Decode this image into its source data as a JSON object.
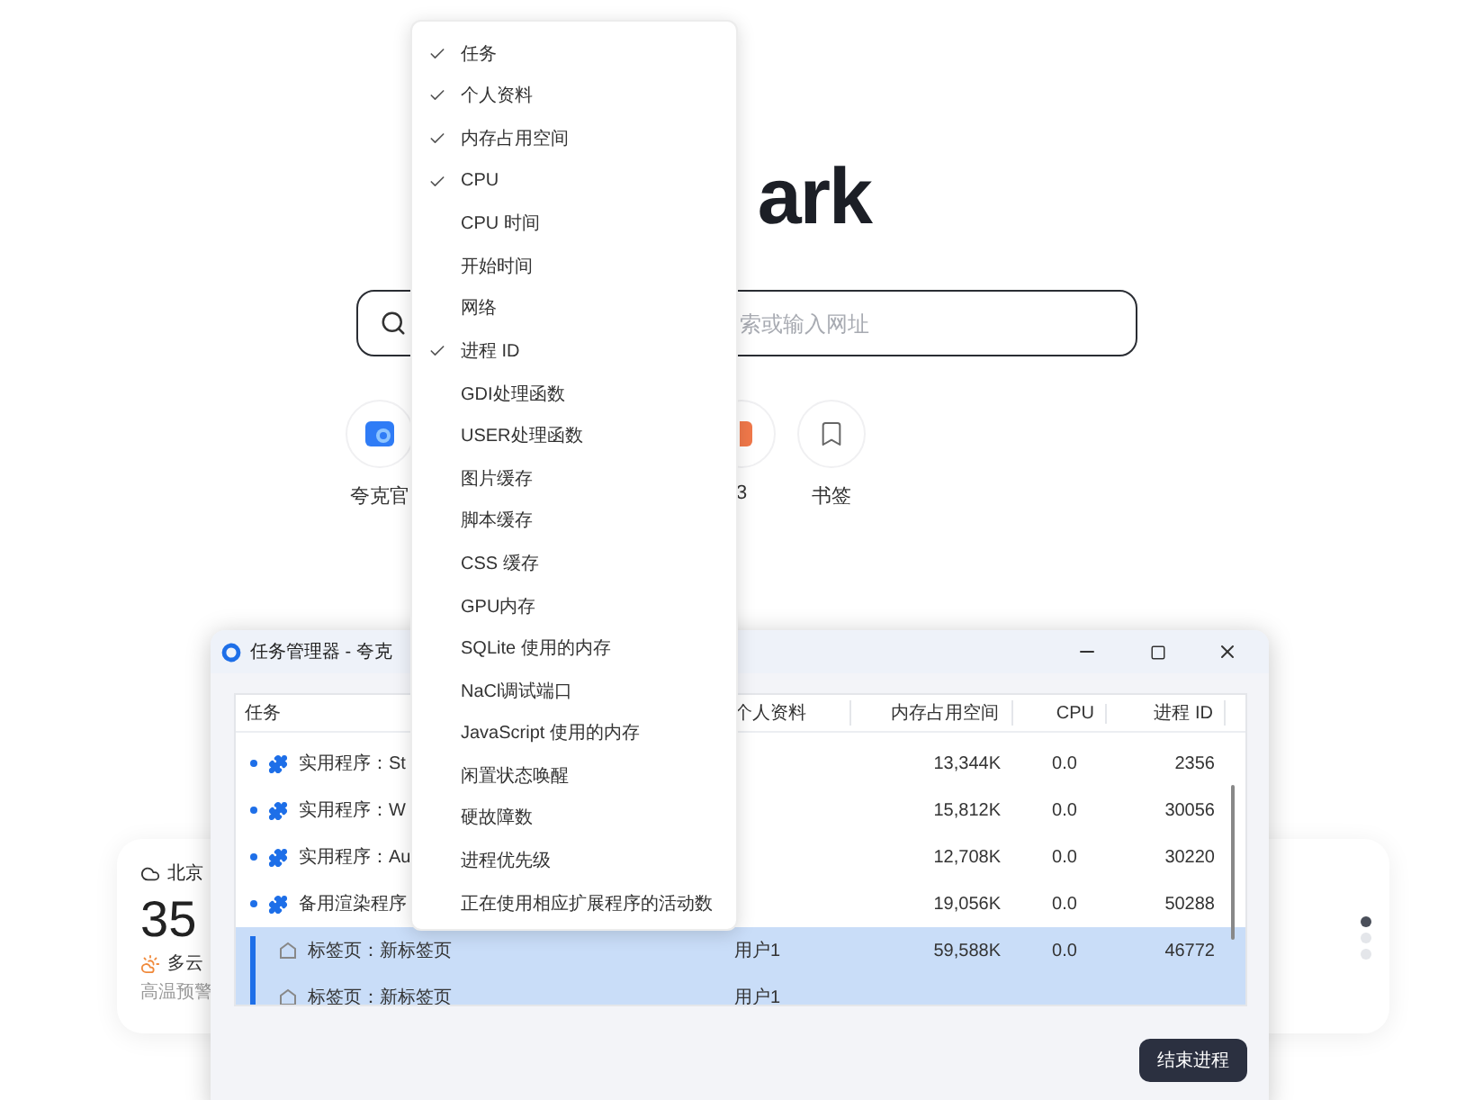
{
  "logo": {
    "text": "ark"
  },
  "search": {
    "placeholder": "索或输入网址"
  },
  "shortcuts": [
    {
      "label": "夸克官",
      "kind": "website"
    },
    {
      "label": "3",
      "kind": "app"
    },
    {
      "label": "书签",
      "kind": "bookmark"
    }
  ],
  "weather": {
    "city": "北京",
    "temperature": "35",
    "condition": "多云",
    "alert": "高温预警"
  },
  "task_manager": {
    "title": "任务管理器 - 夸克",
    "columns": [
      "任务",
      "个人资料",
      "内存占用空间",
      "CPU",
      "进程 ID"
    ],
    "rows": [
      {
        "task": "实用程序：St",
        "kind": "utility",
        "memory": "13,344K",
        "cpu": "0.0",
        "pid": "2356",
        "selected": false
      },
      {
        "task": "实用程序：W",
        "kind": "utility",
        "memory": "15,812K",
        "cpu": "0.0",
        "pid": "30056",
        "selected": false
      },
      {
        "task": "实用程序：Au",
        "kind": "utility",
        "memory": "12,708K",
        "cpu": "0.0",
        "pid": "30220",
        "selected": false
      },
      {
        "task": "备用渲染程序",
        "kind": "utility",
        "memory": "19,056K",
        "cpu": "0.0",
        "pid": "50288",
        "selected": false
      },
      {
        "task": "标签页：新标签页",
        "kind": "tab",
        "profile": "用户1",
        "memory": "59,588K",
        "cpu": "0.0",
        "pid": "46772",
        "selected": true
      },
      {
        "task": "标签页：新标签页",
        "kind": "tab",
        "profile": "用户1",
        "selected": true
      }
    ],
    "button": "结束进程"
  },
  "context_menu": {
    "items": [
      {
        "label": "任务",
        "checked": true
      },
      {
        "label": "个人资料",
        "checked": true
      },
      {
        "label": "内存占用空间",
        "checked": true
      },
      {
        "label": "CPU",
        "checked": true
      },
      {
        "label": "CPU 时间",
        "checked": false
      },
      {
        "label": "开始时间",
        "checked": false
      },
      {
        "label": "网络",
        "checked": false
      },
      {
        "label": "进程 ID",
        "checked": true
      },
      {
        "label": "GDI处理函数",
        "checked": false
      },
      {
        "label": "USER处理函数",
        "checked": false
      },
      {
        "label": "图片缓存",
        "checked": false
      },
      {
        "label": "脚本缓存",
        "checked": false
      },
      {
        "label": "CSS 缓存",
        "checked": false
      },
      {
        "label": "GPU内存",
        "checked": false
      },
      {
        "label": "SQLite 使用的内存",
        "checked": false
      },
      {
        "label": "NaCl调试端口",
        "checked": false
      },
      {
        "label": "JavaScript 使用的内存",
        "checked": false
      },
      {
        "label": "闲置状态唤醒",
        "checked": false
      },
      {
        "label": "硬故障数",
        "checked": false
      },
      {
        "label": "进程优先级",
        "checked": false
      },
      {
        "label": "正在使用相应扩展程序的活动数",
        "checked": false
      }
    ]
  }
}
